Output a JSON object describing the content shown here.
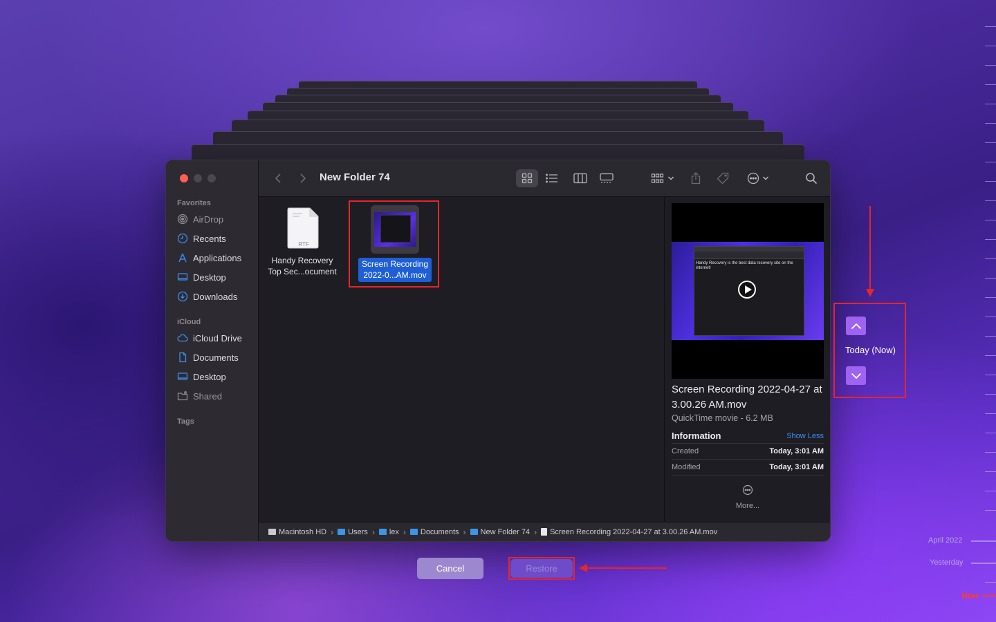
{
  "finder": {
    "title": "New Folder 74",
    "sidebar": {
      "favorites_label": "Favorites",
      "favorites": [
        {
          "label": "AirDrop",
          "icon": "airdrop-icon"
        },
        {
          "label": "Recents",
          "icon": "clock-icon"
        },
        {
          "label": "Applications",
          "icon": "applications-icon"
        },
        {
          "label": "Desktop",
          "icon": "desktop-icon"
        },
        {
          "label": "Downloads",
          "icon": "download-icon"
        }
      ],
      "icloud_label": "iCloud",
      "icloud": [
        {
          "label": "iCloud Drive",
          "icon": "cloud-icon"
        },
        {
          "label": "Documents",
          "icon": "document-icon"
        },
        {
          "label": "Desktop",
          "icon": "desktop-icon"
        },
        {
          "label": "Shared",
          "icon": "shared-folder-icon"
        }
      ],
      "tags_label": "Tags"
    },
    "files": [
      {
        "name_line1": "Handy Recovery",
        "name_line2": "Top Sec...ocument",
        "badge": "RTF",
        "selected": false
      },
      {
        "name_line1": "Screen Recording",
        "name_line2": "2022-0...AM.mov",
        "selected": true
      }
    ],
    "preview": {
      "video_caption": "Handy Recovery is the best data recovery site on the internet!",
      "name": "Screen Recording 2022-04-27 at 3.00.26 AM.mov",
      "kind": "QuickTime movie - 6.2 MB",
      "info_label": "Information",
      "show_less": "Show Less",
      "created_label": "Created",
      "created_value": "Today, 3:01 AM",
      "modified_label": "Modified",
      "modified_value": "Today, 3:01 AM",
      "more_label": "More..."
    },
    "path": [
      {
        "label": "Macintosh HD",
        "icon": "disk-icon"
      },
      {
        "label": "Users",
        "icon": "folder-icon"
      },
      {
        "label": "lex",
        "icon": "folder-icon"
      },
      {
        "label": "Documents",
        "icon": "folder-icon"
      },
      {
        "label": "New Folder 74",
        "icon": "folder-icon"
      },
      {
        "label": "Screen Recording 2022-04-27 at 3.00.26 AM.mov",
        "icon": "movie-file-icon"
      }
    ]
  },
  "buttons": {
    "cancel": "Cancel",
    "restore": "Restore"
  },
  "timemachine": {
    "current": "Today (Now)"
  },
  "timeline": {
    "april": "April 2022",
    "yesterday": "Yesterday",
    "now": "Now"
  },
  "colors": {
    "accent": "#1f5fd6",
    "annotation": "#e5262a",
    "tm_button": "#9e63f0",
    "now": "#ff3b30"
  }
}
